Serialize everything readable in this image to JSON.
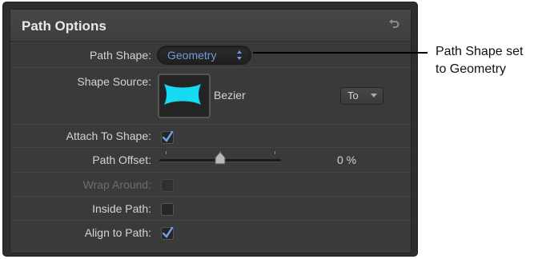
{
  "panel": {
    "title": "Path Options",
    "reset_icon": "reset-arrow-icon"
  },
  "rows": {
    "path_shape": {
      "label": "Path Shape:",
      "value": "Geometry"
    },
    "shape_source": {
      "label": "Shape Source:",
      "source_name": "Bezier",
      "to_button": "To"
    },
    "attach_to_shape": {
      "label": "Attach To Shape:",
      "checked": true
    },
    "path_offset": {
      "label": "Path Offset:",
      "value": "0 %",
      "slider_fraction": 0.5
    },
    "wrap_around": {
      "label": "Wrap Around:",
      "checked": false,
      "enabled": false
    },
    "inside_path": {
      "label": "Inside Path:",
      "checked": false
    },
    "align_to_path": {
      "label": "Align to Path:",
      "checked": true
    }
  },
  "callout": {
    "line1": "Path Shape set",
    "line2": "to Geometry"
  },
  "colors": {
    "accent_blue": "#6f9be0",
    "checkmark": "#6fa3ef",
    "shape_fill": "#16d9f2"
  }
}
